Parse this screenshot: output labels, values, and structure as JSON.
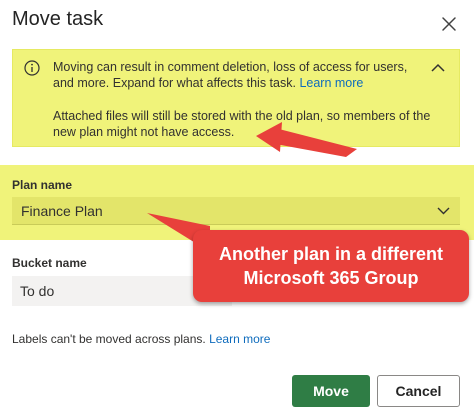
{
  "dialog": {
    "title": "Move task",
    "close_icon": "close-icon"
  },
  "warning": {
    "icon": "info-icon",
    "text": "Moving can result in comment deletion, loss of access for users, and more. Expand for what affects this task.",
    "link": "Learn more",
    "detail": "Attached files will still be stored with the old plan, so members of the new plan might not have access.",
    "collapse_icon": "chevron-up-icon"
  },
  "plan": {
    "label": "Plan name",
    "value": "Finance Plan",
    "dropdown_icon": "chevron-down-icon"
  },
  "bucket": {
    "label": "Bucket name",
    "value": "To do"
  },
  "labels_note": {
    "text": "Labels can't be moved across plans.",
    "link": "Learn more"
  },
  "actions": {
    "move": "Move",
    "cancel": "Cancel"
  },
  "annotation": {
    "line1": "Another plan in a different",
    "line2": "Microsoft 365 Group"
  },
  "colors": {
    "highlight": "#f0f37a",
    "primary_button": "#2f7d45",
    "callout": "#e8403b",
    "link": "#0f6cbd"
  }
}
